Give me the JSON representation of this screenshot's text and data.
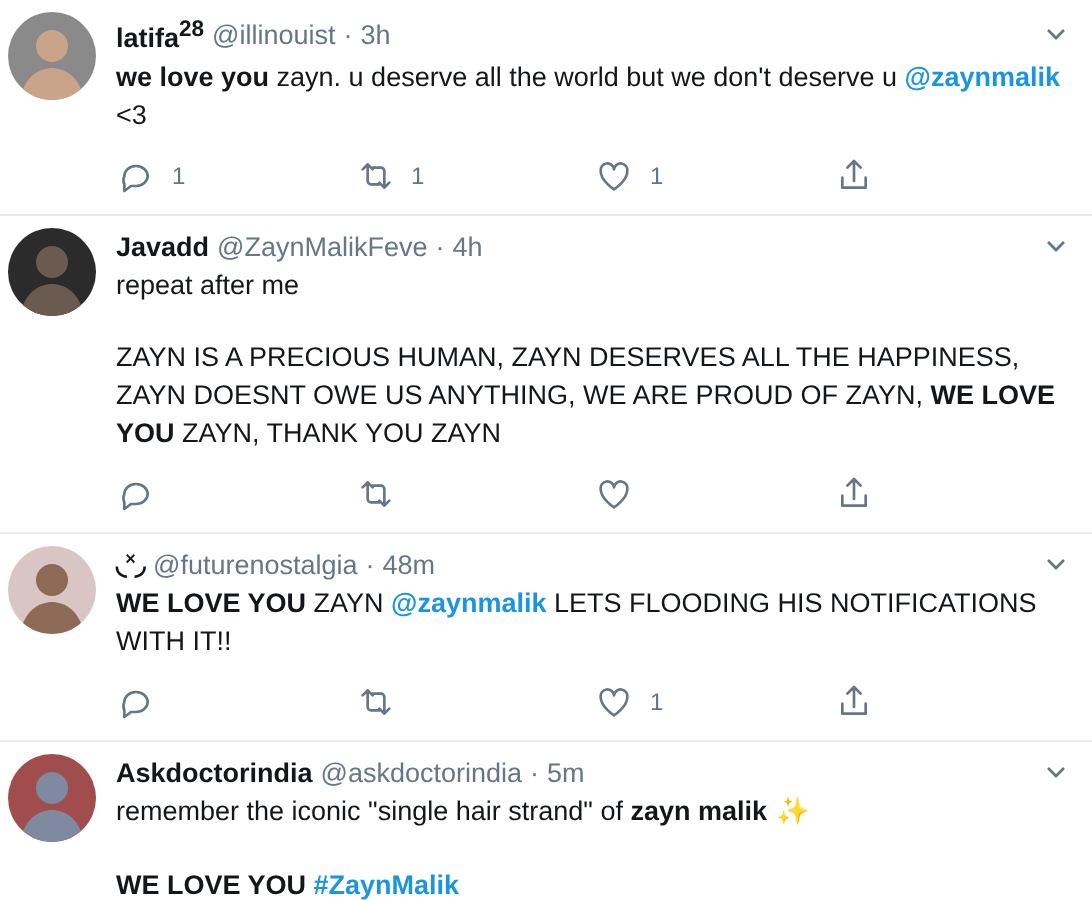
{
  "tweets": [
    {
      "name": "latifa$^{28}$",
      "handle": "@illinouist",
      "separator": "·",
      "time": "3h",
      "paragraphs": [
        [
          {
            "kind": "bold",
            "text": "we love you"
          },
          {
            "kind": "plain",
            "text": " zayn. u deserve all the world but we don't deserve u "
          },
          {
            "kind": "link",
            "text": "@zaynmalik"
          },
          {
            "kind": "plain",
            "text": " <3"
          }
        ]
      ],
      "actions": [
        {
          "kind": "reply",
          "count": "1"
        },
        {
          "kind": "retweet",
          "count": "1"
        },
        {
          "kind": "like",
          "count": "1"
        },
        {
          "kind": "share"
        }
      ]
    },
    {
      "name": "Javadd",
      "handle": "@ZaynMalikFeve",
      "separator": "·",
      "time": "4h",
      "paragraphs": [
        [
          {
            "kind": "plain",
            "text": "repeat after me"
          }
        ],
        [
          {
            "kind": "plain",
            "text": "ZAYN IS A PRECIOUS HUMAN, ZAYN DESERVES ALL THE HAPPINESS, ZAYN DOESNT OWE US ANYTHING, WE ARE PROUD OF ZAYN, "
          },
          {
            "kind": "bold",
            "text": "WE LOVE YOU"
          },
          {
            "kind": "plain",
            "text": " ZAYN, THANK YOU ZAYN"
          }
        ]
      ],
      "actions": [
        {
          "kind": "reply"
        },
        {
          "kind": "retweet"
        },
        {
          "kind": "like"
        },
        {
          "kind": "share"
        }
      ]
    },
    {
      "name": "◟˟◞",
      "handle": "@futurenostalgia",
      "separator": "·",
      "time": "48m",
      "paragraphs": [
        [
          {
            "kind": "bold",
            "text": "WE LOVE YOU"
          },
          {
            "kind": "plain",
            "text": " ZAYN "
          },
          {
            "kind": "link",
            "text": "@zaynmalik"
          },
          {
            "kind": "plain",
            "text": " LETS FLOODING HIS NOTIFICATIONS WITH IT!!"
          }
        ]
      ],
      "actions": [
        {
          "kind": "reply"
        },
        {
          "kind": "retweet"
        },
        {
          "kind": "like",
          "count": "1"
        },
        {
          "kind": "share"
        }
      ]
    },
    {
      "name": "Askdoctorindia",
      "handle": "@askdoctorindia",
      "separator": "·",
      "time": "5m",
      "paragraphs": [
        [
          {
            "kind": "plain",
            "text": "remember the iconic \"single hair strand\" of "
          },
          {
            "kind": "bold",
            "text": "zayn malik"
          },
          {
            "kind": "emoji",
            "text": " ✨"
          }
        ],
        [
          {
            "kind": "bold",
            "text": "WE LOVE YOU "
          },
          {
            "kind": "link",
            "text": "#ZaynMalik"
          }
        ]
      ]
    }
  ]
}
